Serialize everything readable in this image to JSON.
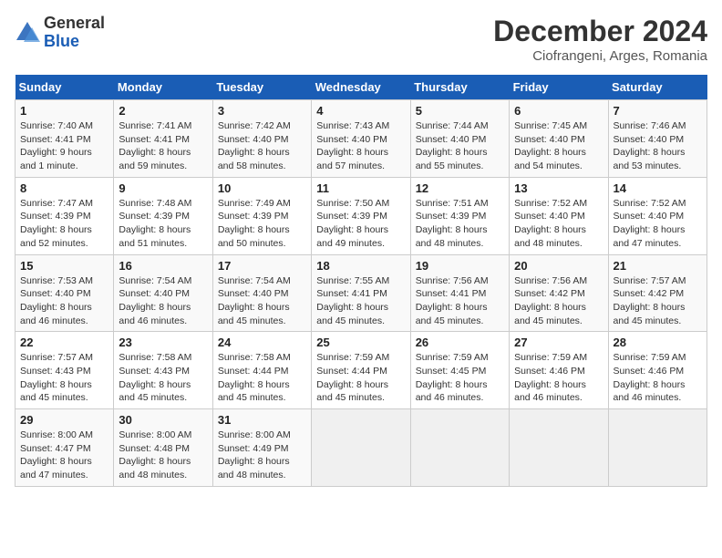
{
  "header": {
    "logo_line1": "General",
    "logo_line2": "Blue",
    "month": "December 2024",
    "location": "Ciofrangeni, Arges, Romania"
  },
  "columns": [
    "Sunday",
    "Monday",
    "Tuesday",
    "Wednesday",
    "Thursday",
    "Friday",
    "Saturday"
  ],
  "weeks": [
    [
      {
        "day": "1",
        "sunrise": "Sunrise: 7:40 AM",
        "sunset": "Sunset: 4:41 PM",
        "daylight": "Daylight: 9 hours and 1 minute."
      },
      {
        "day": "2",
        "sunrise": "Sunrise: 7:41 AM",
        "sunset": "Sunset: 4:41 PM",
        "daylight": "Daylight: 8 hours and 59 minutes."
      },
      {
        "day": "3",
        "sunrise": "Sunrise: 7:42 AM",
        "sunset": "Sunset: 4:40 PM",
        "daylight": "Daylight: 8 hours and 58 minutes."
      },
      {
        "day": "4",
        "sunrise": "Sunrise: 7:43 AM",
        "sunset": "Sunset: 4:40 PM",
        "daylight": "Daylight: 8 hours and 57 minutes."
      },
      {
        "day": "5",
        "sunrise": "Sunrise: 7:44 AM",
        "sunset": "Sunset: 4:40 PM",
        "daylight": "Daylight: 8 hours and 55 minutes."
      },
      {
        "day": "6",
        "sunrise": "Sunrise: 7:45 AM",
        "sunset": "Sunset: 4:40 PM",
        "daylight": "Daylight: 8 hours and 54 minutes."
      },
      {
        "day": "7",
        "sunrise": "Sunrise: 7:46 AM",
        "sunset": "Sunset: 4:40 PM",
        "daylight": "Daylight: 8 hours and 53 minutes."
      }
    ],
    [
      {
        "day": "8",
        "sunrise": "Sunrise: 7:47 AM",
        "sunset": "Sunset: 4:39 PM",
        "daylight": "Daylight: 8 hours and 52 minutes."
      },
      {
        "day": "9",
        "sunrise": "Sunrise: 7:48 AM",
        "sunset": "Sunset: 4:39 PM",
        "daylight": "Daylight: 8 hours and 51 minutes."
      },
      {
        "day": "10",
        "sunrise": "Sunrise: 7:49 AM",
        "sunset": "Sunset: 4:39 PM",
        "daylight": "Daylight: 8 hours and 50 minutes."
      },
      {
        "day": "11",
        "sunrise": "Sunrise: 7:50 AM",
        "sunset": "Sunset: 4:39 PM",
        "daylight": "Daylight: 8 hours and 49 minutes."
      },
      {
        "day": "12",
        "sunrise": "Sunrise: 7:51 AM",
        "sunset": "Sunset: 4:39 PM",
        "daylight": "Daylight: 8 hours and 48 minutes."
      },
      {
        "day": "13",
        "sunrise": "Sunrise: 7:52 AM",
        "sunset": "Sunset: 4:40 PM",
        "daylight": "Daylight: 8 hours and 48 minutes."
      },
      {
        "day": "14",
        "sunrise": "Sunrise: 7:52 AM",
        "sunset": "Sunset: 4:40 PM",
        "daylight": "Daylight: 8 hours and 47 minutes."
      }
    ],
    [
      {
        "day": "15",
        "sunrise": "Sunrise: 7:53 AM",
        "sunset": "Sunset: 4:40 PM",
        "daylight": "Daylight: 8 hours and 46 minutes."
      },
      {
        "day": "16",
        "sunrise": "Sunrise: 7:54 AM",
        "sunset": "Sunset: 4:40 PM",
        "daylight": "Daylight: 8 hours and 46 minutes."
      },
      {
        "day": "17",
        "sunrise": "Sunrise: 7:54 AM",
        "sunset": "Sunset: 4:40 PM",
        "daylight": "Daylight: 8 hours and 45 minutes."
      },
      {
        "day": "18",
        "sunrise": "Sunrise: 7:55 AM",
        "sunset": "Sunset: 4:41 PM",
        "daylight": "Daylight: 8 hours and 45 minutes."
      },
      {
        "day": "19",
        "sunrise": "Sunrise: 7:56 AM",
        "sunset": "Sunset: 4:41 PM",
        "daylight": "Daylight: 8 hours and 45 minutes."
      },
      {
        "day": "20",
        "sunrise": "Sunrise: 7:56 AM",
        "sunset": "Sunset: 4:42 PM",
        "daylight": "Daylight: 8 hours and 45 minutes."
      },
      {
        "day": "21",
        "sunrise": "Sunrise: 7:57 AM",
        "sunset": "Sunset: 4:42 PM",
        "daylight": "Daylight: 8 hours and 45 minutes."
      }
    ],
    [
      {
        "day": "22",
        "sunrise": "Sunrise: 7:57 AM",
        "sunset": "Sunset: 4:43 PM",
        "daylight": "Daylight: 8 hours and 45 minutes."
      },
      {
        "day": "23",
        "sunrise": "Sunrise: 7:58 AM",
        "sunset": "Sunset: 4:43 PM",
        "daylight": "Daylight: 8 hours and 45 minutes."
      },
      {
        "day": "24",
        "sunrise": "Sunrise: 7:58 AM",
        "sunset": "Sunset: 4:44 PM",
        "daylight": "Daylight: 8 hours and 45 minutes."
      },
      {
        "day": "25",
        "sunrise": "Sunrise: 7:59 AM",
        "sunset": "Sunset: 4:44 PM",
        "daylight": "Daylight: 8 hours and 45 minutes."
      },
      {
        "day": "26",
        "sunrise": "Sunrise: 7:59 AM",
        "sunset": "Sunset: 4:45 PM",
        "daylight": "Daylight: 8 hours and 46 minutes."
      },
      {
        "day": "27",
        "sunrise": "Sunrise: 7:59 AM",
        "sunset": "Sunset: 4:46 PM",
        "daylight": "Daylight: 8 hours and 46 minutes."
      },
      {
        "day": "28",
        "sunrise": "Sunrise: 7:59 AM",
        "sunset": "Sunset: 4:46 PM",
        "daylight": "Daylight: 8 hours and 46 minutes."
      }
    ],
    [
      {
        "day": "29",
        "sunrise": "Sunrise: 8:00 AM",
        "sunset": "Sunset: 4:47 PM",
        "daylight": "Daylight: 8 hours and 47 minutes."
      },
      {
        "day": "30",
        "sunrise": "Sunrise: 8:00 AM",
        "sunset": "Sunset: 4:48 PM",
        "daylight": "Daylight: 8 hours and 48 minutes."
      },
      {
        "day": "31",
        "sunrise": "Sunrise: 8:00 AM",
        "sunset": "Sunset: 4:49 PM",
        "daylight": "Daylight: 8 hours and 48 minutes."
      },
      null,
      null,
      null,
      null
    ]
  ]
}
